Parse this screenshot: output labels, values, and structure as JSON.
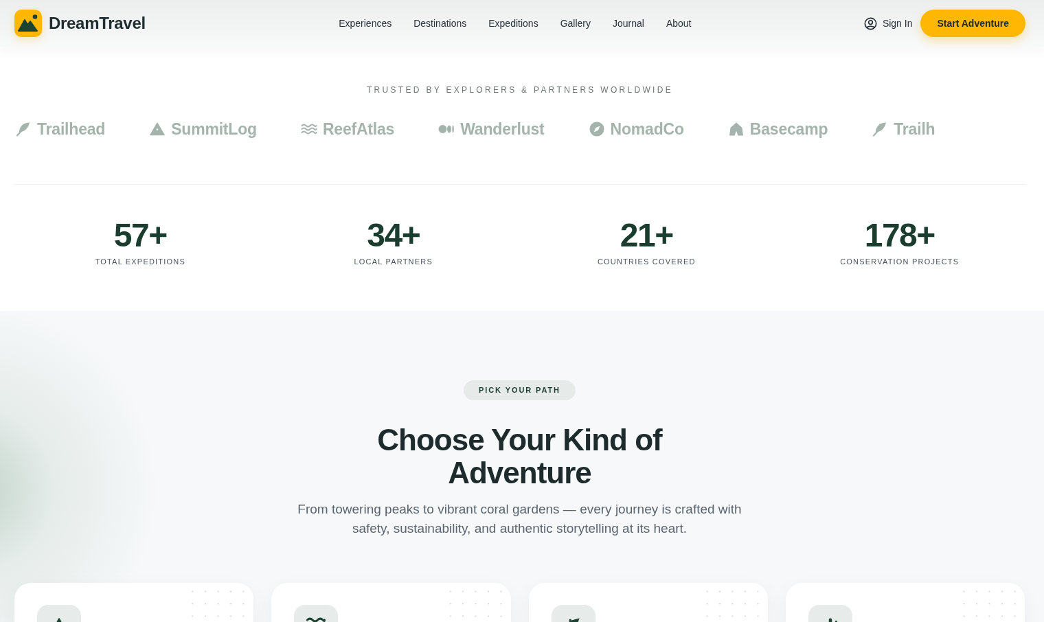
{
  "header": {
    "brand": "DreamTravel",
    "nav": [
      "Experiences",
      "Destinations",
      "Expeditions",
      "Gallery",
      "Journal",
      "About"
    ],
    "sign_in": "Sign In",
    "cta": "Start Adventure"
  },
  "partners": {
    "heading": "TRUSTED BY EXPLORERS & PARTNERS WORLDWIDE",
    "logos": [
      {
        "name": "Trailhead",
        "kind": "feather"
      },
      {
        "name": "SummitLog",
        "kind": "peak"
      },
      {
        "name": "ReefAtlas",
        "kind": "waves"
      },
      {
        "name": "Wanderlust",
        "kind": "circles"
      },
      {
        "name": "NomadCo",
        "kind": "compass"
      },
      {
        "name": "Basecamp",
        "kind": "tent"
      },
      {
        "name": "Trailh",
        "kind": "feather"
      }
    ]
  },
  "stats": [
    {
      "value": "57+",
      "label": "TOTAL EXPEDITIONS"
    },
    {
      "value": "34+",
      "label": "LOCAL PARTNERS"
    },
    {
      "value": "21+",
      "label": "COUNTRIES COVERED"
    },
    {
      "value": "178+",
      "label": "CONSERVATION PROJECTS"
    }
  ],
  "adventures": {
    "eyebrow": "PICK YOUR PATH",
    "title": "Choose Your Kind of Adventure",
    "subtitle": "From towering peaks to vibrant coral gardens — every journey is crafted with safety, sustainability, and authentic storytelling at its heart.",
    "cards": [
      {
        "kind": "mountain"
      },
      {
        "kind": "waves"
      },
      {
        "kind": "flag"
      },
      {
        "kind": "cactus"
      }
    ]
  }
}
